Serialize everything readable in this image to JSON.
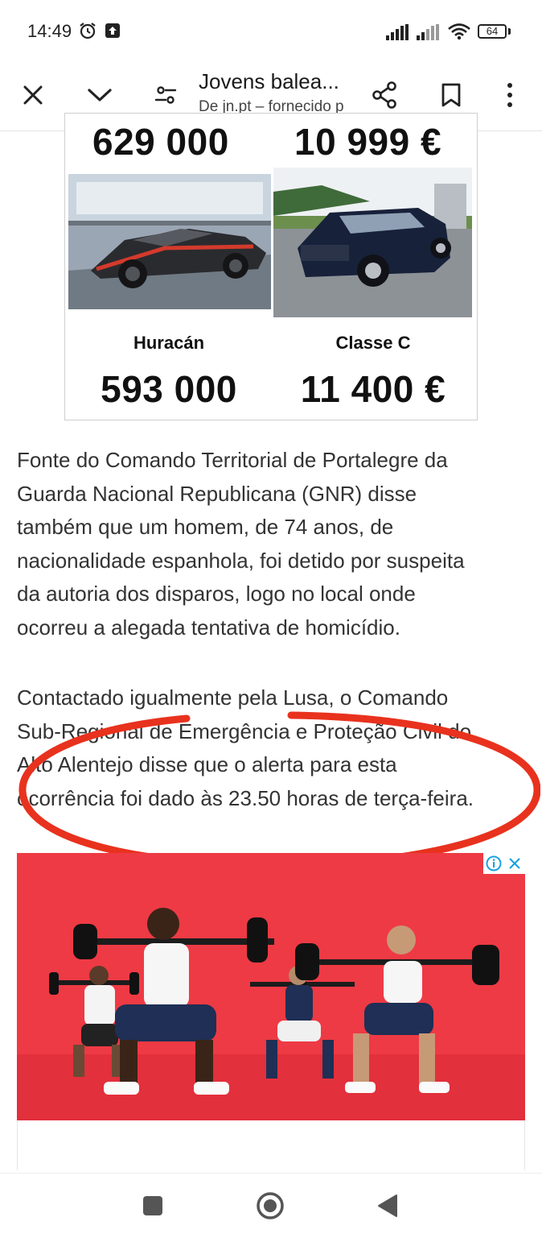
{
  "status_bar": {
    "time": "14:49",
    "battery": "64"
  },
  "toolbar": {
    "title": "Jovens balea...",
    "subtitle": "De jn.pt – fornecido p"
  },
  "cars": {
    "top_left_price": "629 000",
    "top_right_price": "10 999 €",
    "items": [
      {
        "name": "Huracán",
        "price": "593 000"
      },
      {
        "name": "Classe C",
        "price": "11 400 €"
      }
    ]
  },
  "article": {
    "paragraph1_lines": [
      "Fonte do Comando Territorial de Portalegre da",
      "Guarda Nacional Republicana (GNR) disse",
      "também que um homem, de 74 anos, de",
      "nacionalidade espanhola, foi detido por suspeita",
      "da autoria dos disparos, logo no local onde",
      "ocorreu a alegada tentativa de homicídio."
    ],
    "paragraph2_lines": [
      "Contactado igualmente pela Lusa, o Comando",
      "Sub-Regional de Emergência e Proteção Civil do",
      "Alto Alentejo disse que o alerta para esta",
      "ocorrência foi dado às 23.50 horas de terça-feira."
    ]
  },
  "colors": {
    "ad_bg": "#ee3a44",
    "annotation": "#e8321e"
  }
}
